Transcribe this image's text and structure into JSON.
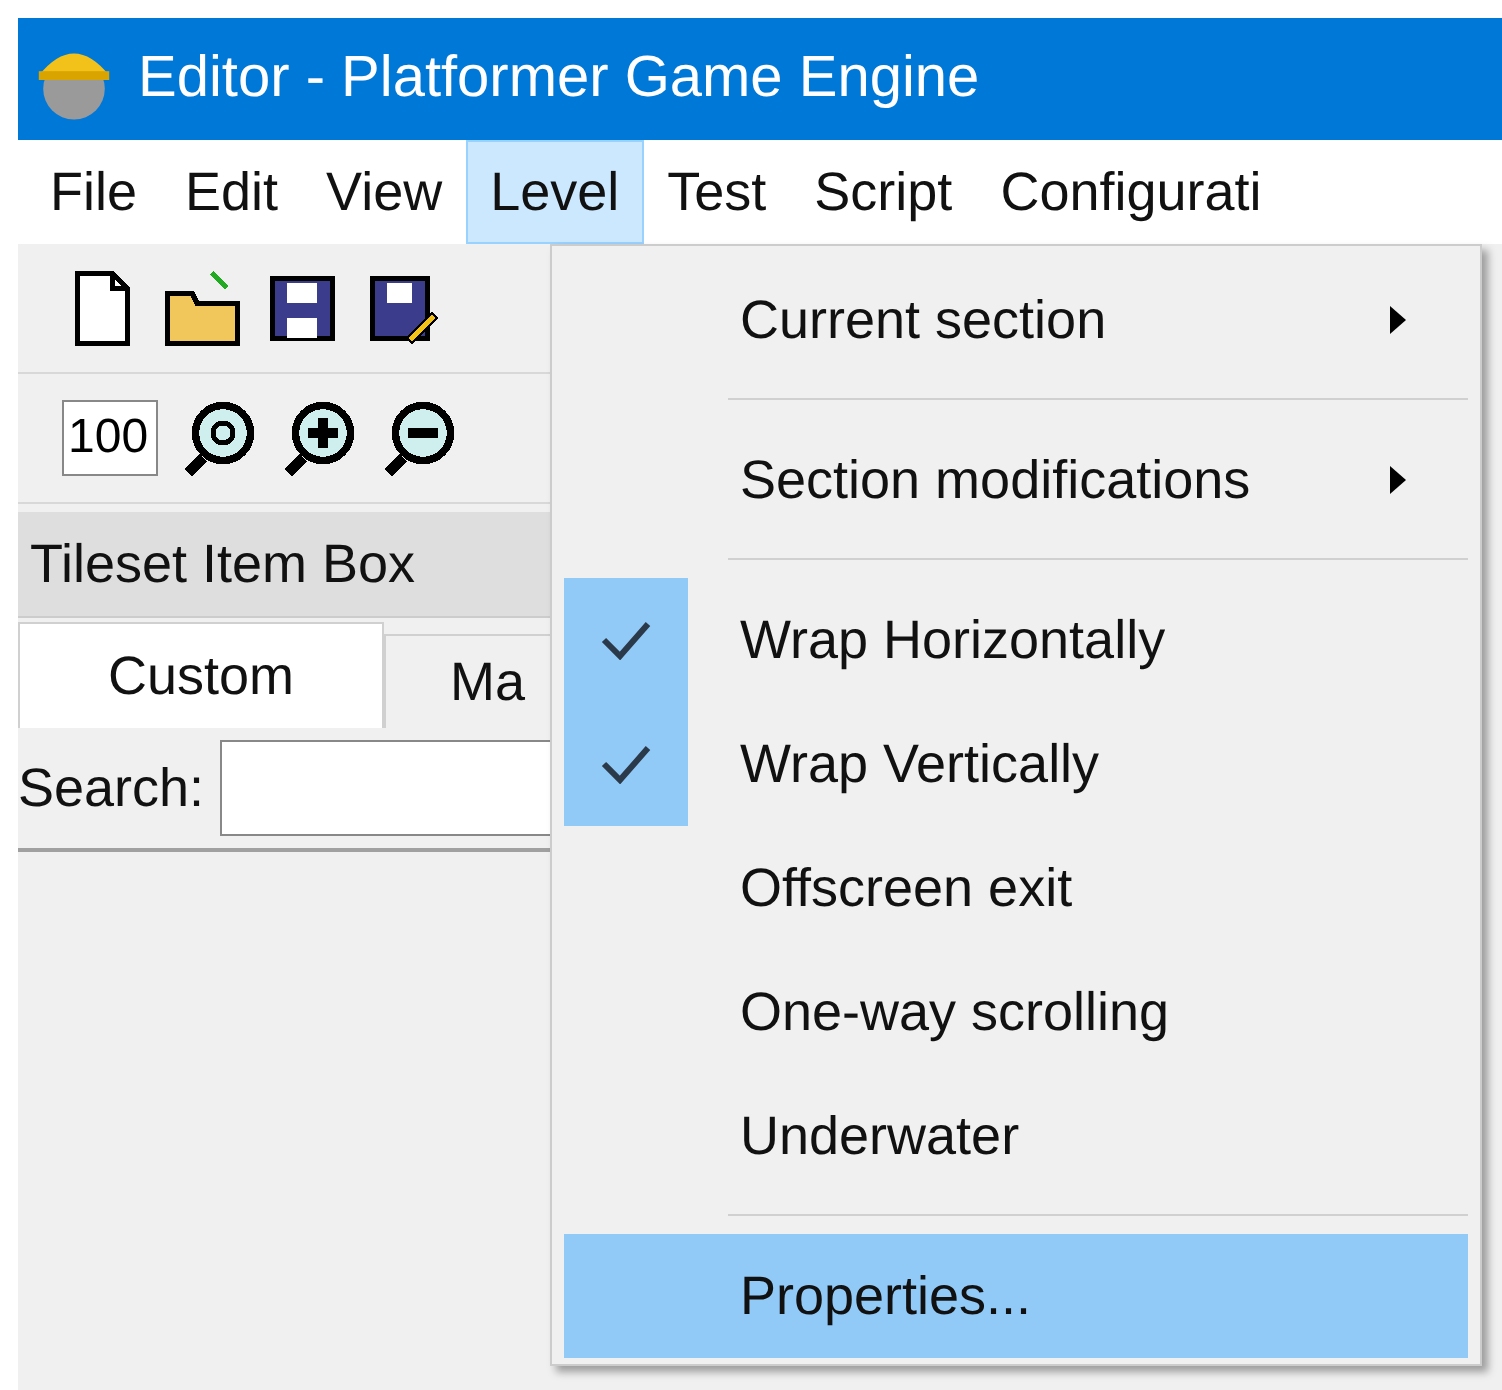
{
  "window": {
    "title": "Editor - Platformer Game Engine"
  },
  "menu_bar": [
    {
      "label": "File",
      "selected": false
    },
    {
      "label": "Edit",
      "selected": false
    },
    {
      "label": "View",
      "selected": false
    },
    {
      "label": "Level",
      "selected": true
    },
    {
      "label": "Test",
      "selected": false
    },
    {
      "label": "Script",
      "selected": false
    },
    {
      "label": "Configurati",
      "selected": false
    }
  ],
  "zoom_field": {
    "value": "100"
  },
  "panel": {
    "title": "Tileset Item Box"
  },
  "tabs": [
    {
      "label": "Custom",
      "selected": true
    },
    {
      "label": "Ma",
      "selected": false
    }
  ],
  "search": {
    "label": "Search:"
  },
  "level_menu": [
    {
      "kind": "item",
      "label": "Current section",
      "checked": false,
      "submenu": true,
      "selected": false
    },
    {
      "kind": "separator"
    },
    {
      "kind": "item",
      "label": "Section modifications",
      "checked": false,
      "submenu": true,
      "selected": false
    },
    {
      "kind": "separator"
    },
    {
      "kind": "item",
      "label": "Wrap Horizontally",
      "checked": true,
      "submenu": false,
      "selected": false
    },
    {
      "kind": "item",
      "label": "Wrap Vertically",
      "checked": true,
      "submenu": false,
      "selected": false
    },
    {
      "kind": "item",
      "label": "Offscreen exit",
      "checked": false,
      "submenu": false,
      "selected": false
    },
    {
      "kind": "item",
      "label": "One-way scrolling",
      "checked": false,
      "submenu": false,
      "selected": false
    },
    {
      "kind": "item",
      "label": "Underwater",
      "checked": false,
      "submenu": false,
      "selected": false
    },
    {
      "kind": "separator"
    },
    {
      "kind": "item",
      "label": "Properties...",
      "checked": false,
      "submenu": false,
      "selected": true
    }
  ]
}
